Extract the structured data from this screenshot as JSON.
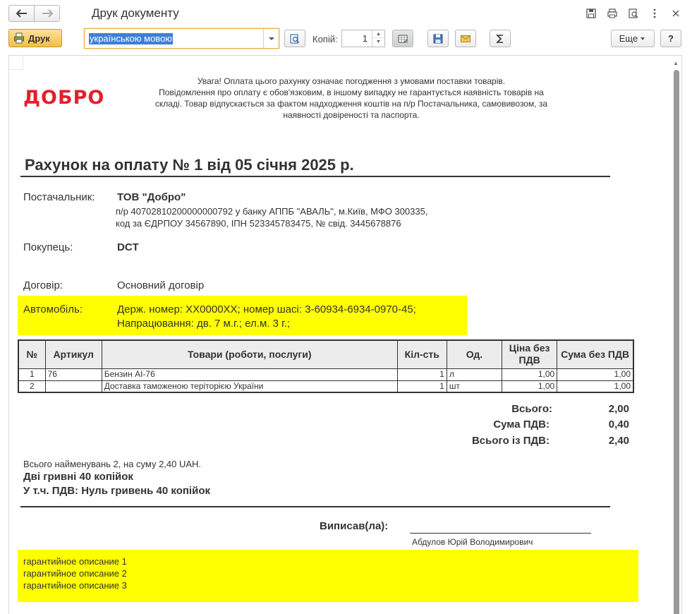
{
  "window": {
    "title": "Друк документу"
  },
  "toolbar": {
    "print_label": "Друк",
    "language_value": "українською мовою",
    "copies_label": "Копій:",
    "copies_value": "1",
    "more_label": "Еще",
    "help_label": "?"
  },
  "document": {
    "logo_text": "ДОБРО",
    "warning_lines": [
      "Увага! Оплата цього рахунку означає погодження з умовами поставки товарів.",
      "Повідомлення про оплату є обов'язковим, в іншому випадку не гарантується наявність товарів на",
      "складі. Товар відпускається за фактом надходження коштів на п/р Постачальника, самовивозом, за",
      "наявності довіреності та паспорта."
    ],
    "title": "Рахунок на оплату № 1 від 05 січня 2025 р.",
    "supplier_label": "Постачальник:",
    "supplier_name": "ТОВ \"Добро\"",
    "supplier_details_1": "п/р 40702810200000000792 у банку АППБ \"АВАЛЬ\", м.Київ, МФО 300335,",
    "supplier_details_2": "код за ЄДРПОУ 34567890, ІПН 523345783475, № свід. 3445678876",
    "buyer_label": "Покупець:",
    "buyer_name": "DCT",
    "contract_label": "Договір:",
    "contract_value": "Основний договір",
    "car_label": "Автомобіль:",
    "car_line_1": "Держ. номер: XX0000XX; номер шасі: 3-60934-6934-0970-45;",
    "car_line_2": "Напрацювання: дв. 7 м.г.; ел.м. 3 г.;",
    "table": {
      "headers": [
        "№",
        "Артикул",
        "Товари (роботи, послуги)",
        "Кіл-сть",
        "Од.",
        "Ціна без ПДВ",
        "Сума без ПДВ"
      ],
      "rows": [
        [
          "1",
          "76",
          "Бензин AI-76",
          "1",
          "л",
          "1,00",
          "1,00"
        ],
        [
          "2",
          "",
          "Доставка таможеною теріторією України",
          "1",
          "шт",
          "1,00",
          "1,00"
        ]
      ]
    },
    "totals": {
      "total_label": "Всього:",
      "total_value": "2,00",
      "vat_label": "Сума ПДВ:",
      "vat_value": "0,40",
      "total_vat_label": "Всього із ПДВ:",
      "total_vat_value": "2,40"
    },
    "summary_line": "Всього найменувань 2, на суму 2,40 UAH.",
    "amount_words": "Дві гривні 40 копійок",
    "vat_words": "У т.ч. ПДВ: Нуль гривень 40 копійок",
    "signed_label": "Виписав(ла):",
    "signer_name": "Абдулов Юрій Володимирович",
    "warranty_lines": [
      "гарантийное описание 1",
      "гарантийное описание 2",
      "гарантийное описание 3"
    ]
  },
  "colors": {
    "accent_orange": "#f3be4a",
    "logo_red": "#e3202c",
    "highlight_yellow": "#ffff00",
    "selection_blue": "#3d7fd6"
  },
  "icons": {
    "back": "arrow-left-icon",
    "forward": "arrow-right-icon",
    "save": "floppy-disk-icon",
    "print": "printer-icon",
    "preview": "magnifier-page-icon",
    "more": "vertical-dots-icon",
    "close": "close-icon"
  }
}
